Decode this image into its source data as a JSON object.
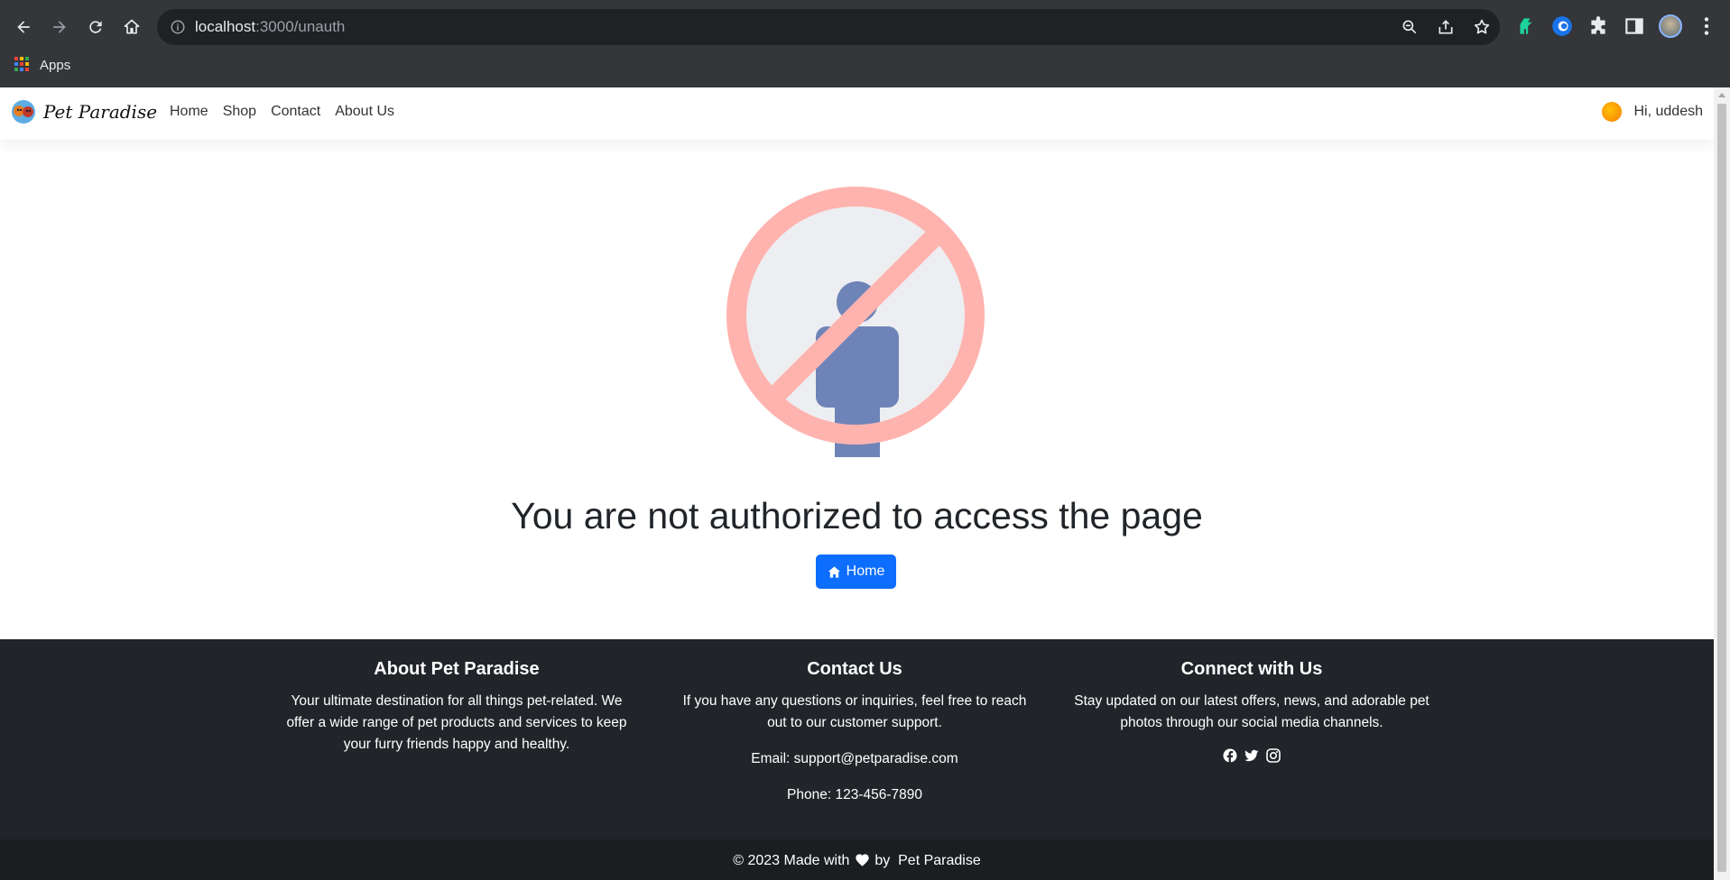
{
  "browser": {
    "url_host": "localhost",
    "url_rest": ":3000/unauth",
    "bookmark_apps": "Apps"
  },
  "navbar": {
    "brand": "Pet Paradise",
    "links": [
      "Home",
      "Shop",
      "Contact",
      "About Us"
    ],
    "greeting": "Hi, uddesh"
  },
  "main": {
    "heading": "You are not authorized to access the page",
    "home_button": "Home"
  },
  "footer": {
    "about": {
      "title": "About Pet Paradise",
      "text": "Your ultimate destination for all things pet-related. We offer a wide range of pet products and services to keep your furry friends happy and healthy."
    },
    "contact": {
      "title": "Contact Us",
      "text": "If you have any questions or inquiries, feel free to reach out to our customer support.",
      "email": "Email: support@petparadise.com",
      "phone": "Phone: 123-456-7890"
    },
    "connect": {
      "title": "Connect with Us",
      "text": "Stay updated on our latest offers, news, and adorable pet photos through our social media channels.",
      "icons": [
        "facebook-icon",
        "twitter-icon",
        "instagram-icon"
      ]
    },
    "copyright_prefix": "© 2023 Made with",
    "copyright_suffix": "by  Pet Paradise"
  },
  "colors": {
    "chrome_bg": "#35363a",
    "omnibox_bg": "#202124",
    "primary": "#0d6efd",
    "footer_bg": "#212529",
    "forbidden_ring": "#ffb3ae",
    "figure": "#6e84b8"
  }
}
